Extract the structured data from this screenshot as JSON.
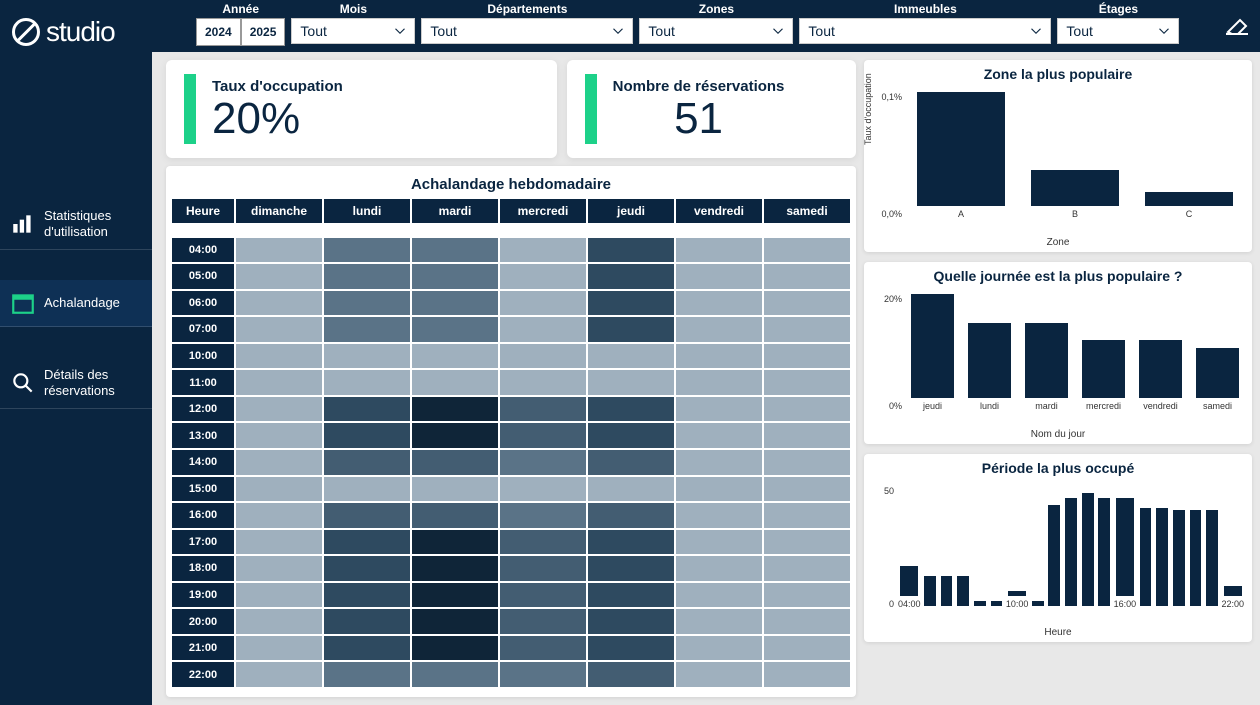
{
  "app": {
    "logo_text": "studio"
  },
  "nav": {
    "items": [
      {
        "label": "Statistiques d'utilisation",
        "icon": "barchart"
      },
      {
        "label": "Achalandage",
        "icon": "calendar",
        "active": true
      },
      {
        "label": "Détails des réservations",
        "icon": "magnify"
      }
    ]
  },
  "filters": {
    "year_label": "Année",
    "years": [
      "2024",
      "2025"
    ],
    "month_label": "Mois",
    "month_value": "Tout",
    "dept_label": "Départements",
    "dept_value": "Tout",
    "zones_label": "Zones",
    "zones_value": "Tout",
    "buildings_label": "Immeubles",
    "buildings_value": "Tout",
    "floors_label": "Étages",
    "floors_value": "Tout"
  },
  "kpi": {
    "occupancy_title": "Taux d'occupation",
    "occupancy_value": "20%",
    "reservations_title": "Nombre de réservations",
    "reservations_value": "51"
  },
  "heatmap": {
    "title": "Achalandage hebdomadaire",
    "hour_header": "Heure",
    "days": [
      "dimanche",
      "lundi",
      "mardi",
      "mercredi",
      "jeudi",
      "vendredi",
      "samedi"
    ],
    "hours": [
      "04:00",
      "05:00",
      "06:00",
      "07:00",
      "10:00",
      "11:00",
      "12:00",
      "13:00",
      "14:00",
      "15:00",
      "16:00",
      "17:00",
      "18:00",
      "19:00",
      "20:00",
      "21:00",
      "22:00"
    ],
    "colors": {
      "0": "#9fb0be",
      "1": "#7a92a3",
      "2": "#5a7387",
      "3": "#435d72",
      "4": "#2e4a60",
      "5": "#1c3449",
      "6": "#0f2538"
    },
    "grid": [
      [
        0,
        2,
        2,
        0,
        4,
        0,
        0
      ],
      [
        0,
        2,
        2,
        0,
        4,
        0,
        0
      ],
      [
        0,
        2,
        2,
        0,
        4,
        0,
        0
      ],
      [
        0,
        2,
        2,
        0,
        4,
        0,
        0
      ],
      [
        0,
        0,
        0,
        0,
        0,
        0,
        0
      ],
      [
        0,
        0,
        0,
        0,
        0,
        0,
        0
      ],
      [
        0,
        4,
        6,
        3,
        4,
        0,
        0
      ],
      [
        0,
        4,
        6,
        3,
        4,
        0,
        0
      ],
      [
        0,
        3,
        3,
        2,
        3,
        0,
        0
      ],
      [
        0,
        0,
        0,
        0,
        0,
        0,
        0
      ],
      [
        0,
        3,
        3,
        2,
        3,
        0,
        0
      ],
      [
        0,
        4,
        6,
        3,
        4,
        0,
        0
      ],
      [
        0,
        4,
        6,
        3,
        4,
        0,
        0
      ],
      [
        0,
        4,
        6,
        3,
        4,
        0,
        0
      ],
      [
        0,
        4,
        6,
        3,
        4,
        0,
        0
      ],
      [
        0,
        4,
        6,
        3,
        4,
        0,
        0
      ],
      [
        0,
        2,
        2,
        2,
        3,
        0,
        0
      ]
    ]
  },
  "chart_data": [
    {
      "id": "zone",
      "type": "bar",
      "title": "Zone la plus populaire",
      "categories": [
        "A",
        "B",
        "C"
      ],
      "values": [
        0.13,
        0.04,
        0.015
      ],
      "ylabel": "Taux d'occupation",
      "xlabel": "Zone",
      "y_ticks": [
        "0,1%",
        "0,0%"
      ],
      "ylim": [
        0,
        0.14
      ]
    },
    {
      "id": "day",
      "type": "bar",
      "title": "Quelle journée est la plus populaire ?",
      "categories": [
        "jeudi",
        "lundi",
        "mardi",
        "mercredi",
        "vendredi",
        "samedi"
      ],
      "values": [
        26,
        18,
        18,
        14,
        14,
        12
      ],
      "xlabel": "Nom du jour",
      "y_ticks": [
        "20%",
        "0%"
      ],
      "ylim": [
        0,
        28
      ]
    },
    {
      "id": "hour",
      "type": "bar",
      "title": "Période la plus occupé",
      "categories": [
        "04:00",
        "05:00",
        "06:00",
        "07:00",
        "08:00",
        "09:00",
        "10:00",
        "11:00",
        "12:00",
        "13:00",
        "14:00",
        "15:00",
        "16:00",
        "17:00",
        "18:00",
        "19:00",
        "20:00",
        "21:00",
        "22:00"
      ],
      "values": [
        12,
        12,
        12,
        12,
        2,
        2,
        2,
        2,
        41,
        44,
        46,
        44,
        40,
        40,
        40,
        39,
        39,
        39,
        4
      ],
      "xlabel": "Heure",
      "x_tick_labels": [
        "04:00",
        "",
        "",
        "",
        "",
        "",
        "10:00",
        "",
        "",
        "",
        "",
        "",
        "16:00",
        "",
        "",
        "",
        "",
        "",
        "22:00"
      ],
      "y_ticks": [
        "50",
        "0"
      ],
      "ylim": [
        0,
        50
      ]
    }
  ]
}
